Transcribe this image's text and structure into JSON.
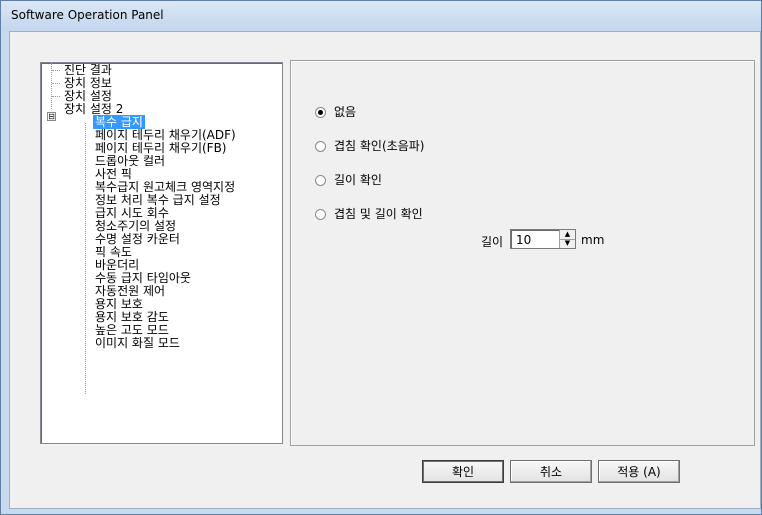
{
  "window": {
    "title": "Software Operation Panel"
  },
  "tree": {
    "items": [
      {
        "label": "진단 결과"
      },
      {
        "label": "장치 정보"
      },
      {
        "label": "장치 설정"
      },
      {
        "label": "장치 설정 2",
        "expander": "⊟"
      },
      {
        "label": "복수 급지",
        "selected": true
      },
      {
        "label": "페이지 테두리 채우기(ADF)"
      },
      {
        "label": "페이지 테두리 채우기(FB)"
      },
      {
        "label": "드롭아웃 컬러"
      },
      {
        "label": "사전 픽"
      },
      {
        "label": "복수급지 원고체크 영역지정"
      },
      {
        "label": "정보 처리 복수 급지 설정"
      },
      {
        "label": "급지 시도 회수"
      },
      {
        "label": "청소주기의 설정"
      },
      {
        "label": "수명 설정 카운터"
      },
      {
        "label": "픽 속도"
      },
      {
        "label": "바운더리"
      },
      {
        "label": "수동 급지 타임아웃"
      },
      {
        "label": "자동전원 제어"
      },
      {
        "label": "용지 보호"
      },
      {
        "label": "용지 보호 감도"
      },
      {
        "label": "높은 고도 모드"
      },
      {
        "label": "이미지 화질 모드"
      }
    ]
  },
  "options": [
    {
      "label": "없음",
      "checked": true
    },
    {
      "label": "겹침 확인(초음파)",
      "checked": false
    },
    {
      "label": "길이 확인",
      "checked": false
    },
    {
      "label": "겹침 및 길이 확인",
      "checked": false
    }
  ],
  "length": {
    "label": "길이",
    "value": "10",
    "unit": "mm"
  },
  "buttons": {
    "ok": "확인",
    "cancel": "취소",
    "apply": "적용 (A)"
  }
}
